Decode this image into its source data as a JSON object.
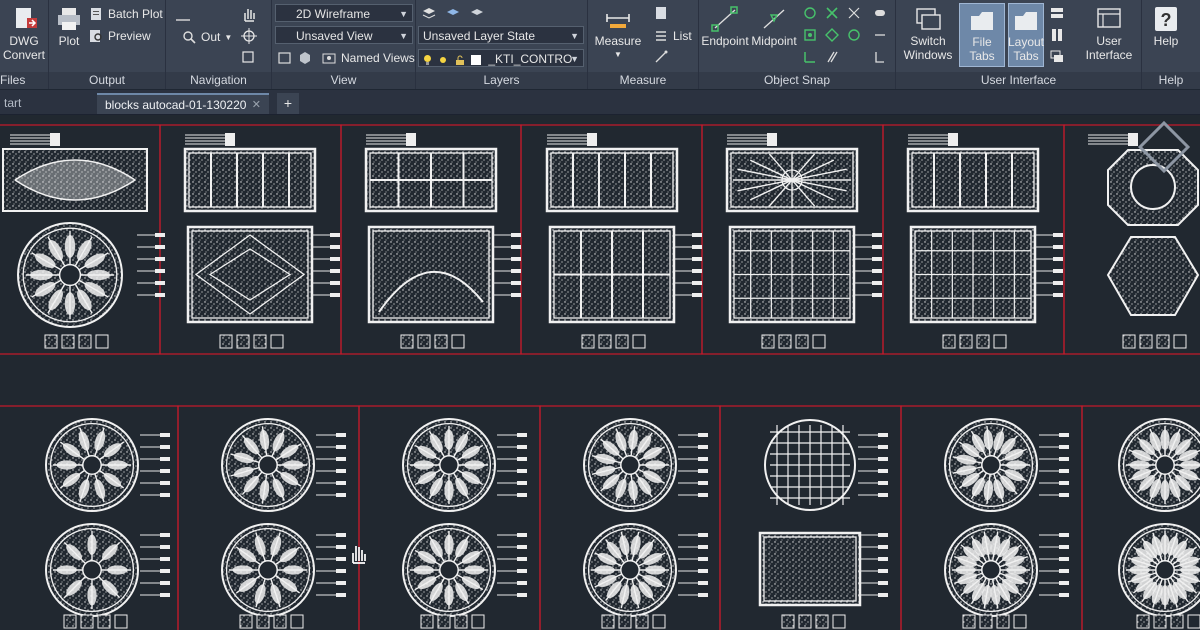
{
  "ribbon": {
    "files": {
      "convert_label": "DWG\nConvert",
      "panel_title": "Files"
    },
    "output": {
      "plot_label": "Plot",
      "batch_plot_label": "Batch Plot",
      "preview_label": "Preview",
      "panel_title": "Output"
    },
    "navigation": {
      "out_label": "Out",
      "panel_title": "Navigation"
    },
    "view": {
      "visual_style": "2D Wireframe",
      "saved_view": "Unsaved View",
      "named_views_label": "Named Views",
      "panel_title": "View"
    },
    "layers": {
      "layer_state": "Unsaved Layer State",
      "current_layer": "_KTI_CONTRO",
      "panel_title": "Layers"
    },
    "measure": {
      "measure_label": "Measure",
      "list_label": "List",
      "panel_title": "Measure"
    },
    "object_snap": {
      "endpoint_label": "Endpoint",
      "midpoint_label": "Midpoint",
      "panel_title": "Object Snap"
    },
    "user_interface": {
      "switch_windows_label": "Switch\nWindows",
      "file_tabs_label": "File Tabs",
      "layout_tabs_label": "Layout\nTabs",
      "user_interface_label": "User\nInterface",
      "panel_title": "User Interface"
    },
    "help": {
      "help_label": "Help",
      "panel_title": "Help"
    }
  },
  "tabs": {
    "start_label": "tart",
    "file_label": "blocks autocad-01-130220",
    "close_glyph": "✕",
    "new_tab_glyph": "+"
  },
  "colors": {
    "accent": "#c8192b",
    "ribbon_bg": "#3b4453",
    "canvas_bg": "#212830",
    "active_tab": "#6e88a8"
  }
}
